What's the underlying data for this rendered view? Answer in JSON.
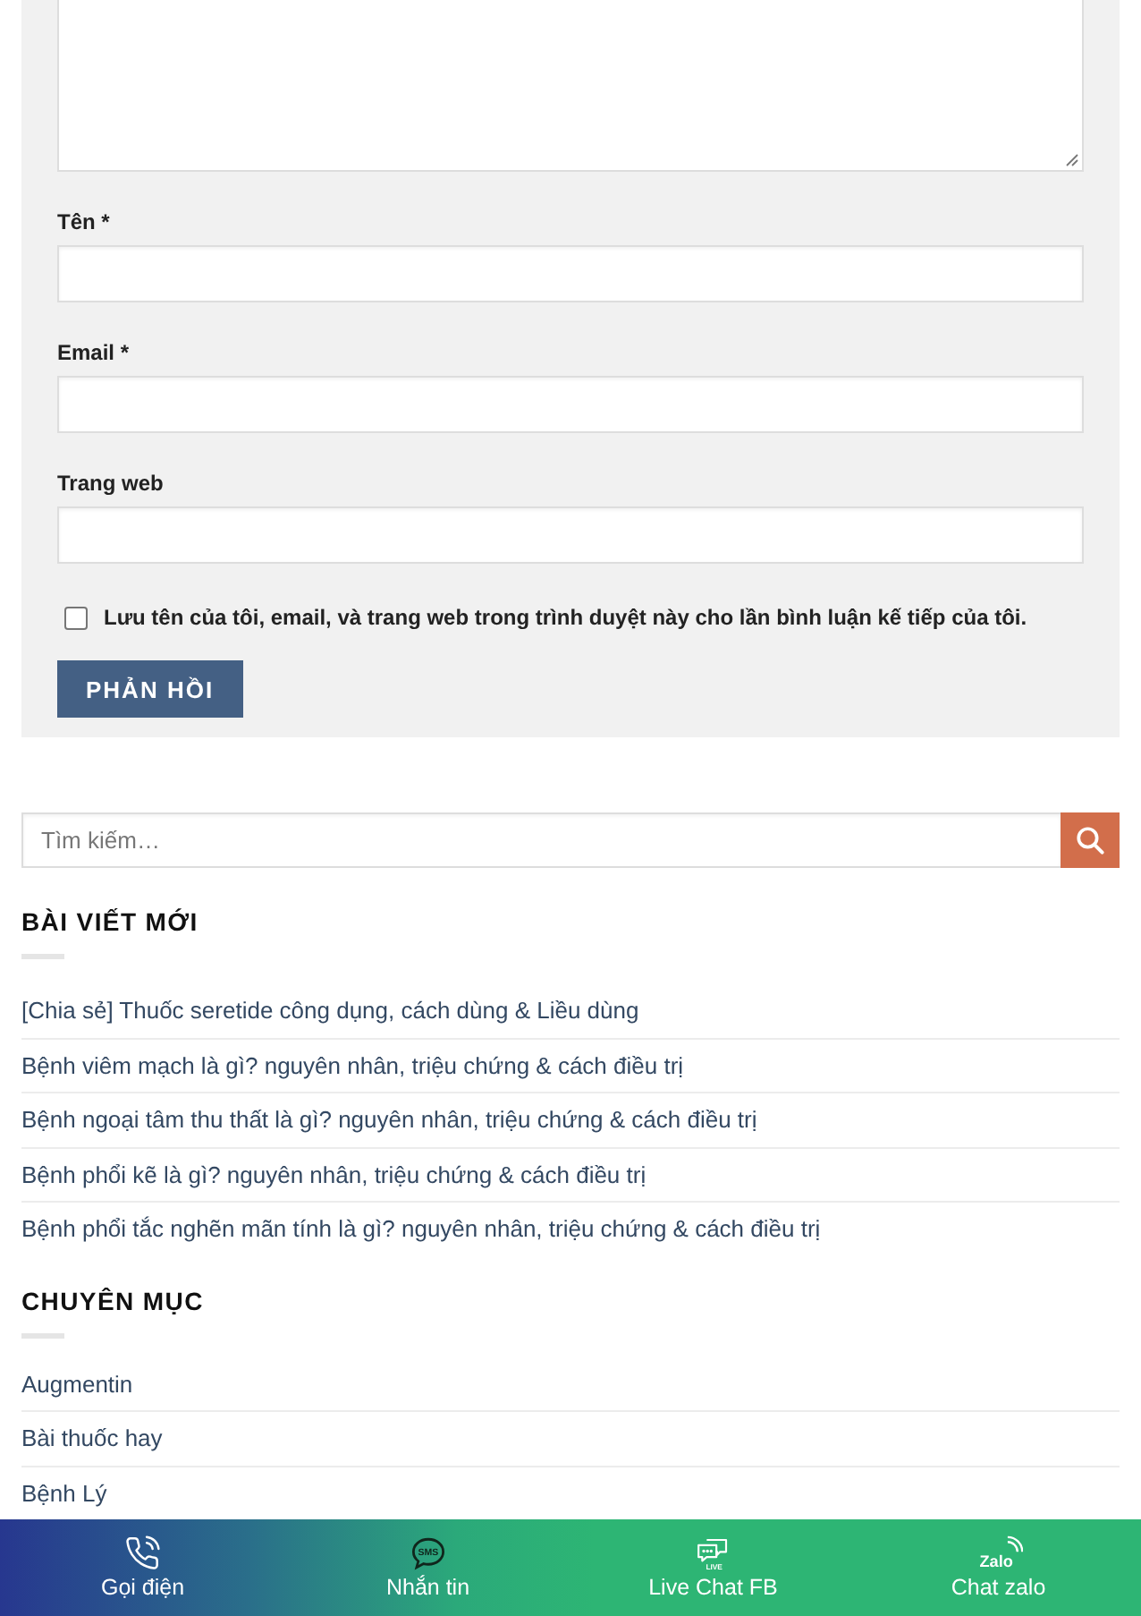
{
  "comment_form": {
    "fields": [
      {
        "kind": "textarea",
        "resizable": true
      },
      {
        "kind": "text",
        "label": "Tên *"
      },
      {
        "kind": "text",
        "label": "Email *"
      },
      {
        "kind": "text",
        "label": "Trang web"
      }
    ],
    "save_info": {
      "checked": false,
      "label": "Lưu tên của tôi, email, và trang web trong trình duyệt này cho lần bình luận kế tiếp của tôi."
    },
    "submit_button": "PHẢN HỒI"
  },
  "search": {
    "placeholder": "Tìm kiếm…"
  },
  "sections": [
    {
      "title": "BÀI VIẾT MỚI",
      "links": [
        "[Chia sẻ] Thuốc seretide công dụng, cách dùng & Liều dùng",
        "Bệnh viêm mạch là gì? nguyên nhân, triệu chứng & cách điều trị",
        "Bệnh ngoại tâm thu thất là gì? nguyên nhân, triệu chứng & cách điều trị",
        "Bệnh phổi kẽ là gì? nguyên nhân, triệu chứng & cách điều trị",
        "Bệnh phổi tắc nghẽn mãn tính là gì? nguyên nhân, triệu chứng & cách điều trị"
      ]
    },
    {
      "title": "CHUYÊN MỤC",
      "links": [
        "Augmentin",
        "Bài thuốc hay",
        "Bệnh Lý"
      ]
    }
  ],
  "contact_bar": [
    {
      "kind": "call",
      "label": "Gọi điện"
    },
    {
      "kind": "sms",
      "label": "Nhắn tin",
      "icon_text": "SMS"
    },
    {
      "kind": "live_chat",
      "label": "Live Chat FB",
      "icon_text": "LIVE"
    },
    {
      "kind": "zalo",
      "label": "Chat zalo",
      "icon_text": "Zalo"
    }
  ]
}
